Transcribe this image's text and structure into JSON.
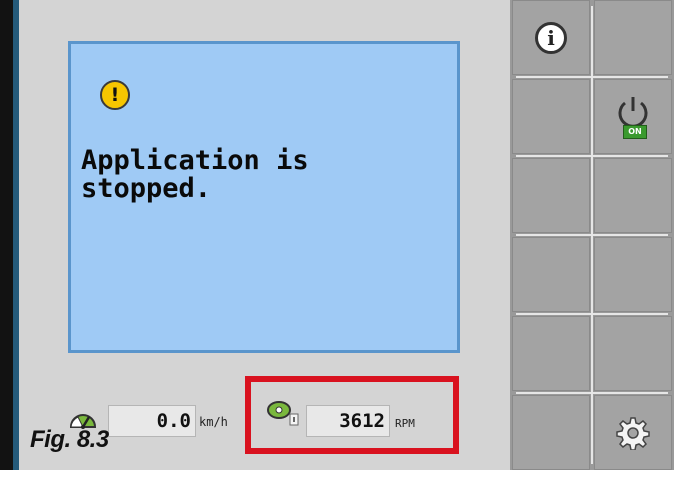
{
  "message": {
    "text": "Application is stopped.",
    "icon": "warning-icon"
  },
  "speed": {
    "icon": "speedometer-icon",
    "value": "0.0",
    "unit": "km/h"
  },
  "rpm": {
    "icon": "fan-icon",
    "value": "3612",
    "unit": "RPM"
  },
  "buttons": {
    "info_icon": "info-icon",
    "power_icon": "power-on-icon",
    "power_badge": "ON",
    "settings_icon": "gear-icon"
  },
  "figure_label": "Fig. 8.3",
  "colors": {
    "panel_bg": "#9fcaf5",
    "highlight": "#d9121f",
    "warning": "#f7c600",
    "on_badge": "#3a9a2e"
  }
}
